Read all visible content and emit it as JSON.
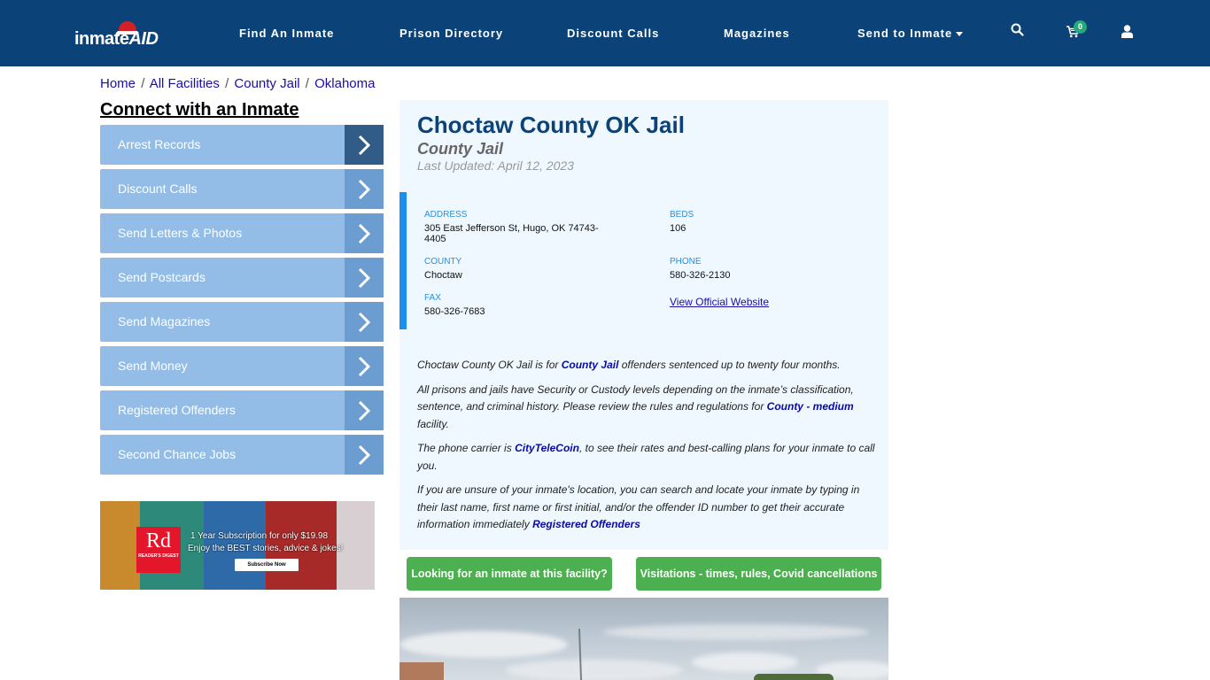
{
  "header": {
    "logo": {
      "part1": "inmate",
      "part2": "AID"
    },
    "nav": [
      {
        "label": "Find An Inmate"
      },
      {
        "label": "Prison Directory"
      },
      {
        "label": "Discount Calls"
      },
      {
        "label": "Magazines"
      },
      {
        "label": "Send to Inmate",
        "has_dropdown": true
      }
    ],
    "icons": {
      "search": "search-icon",
      "cart": "cart-icon",
      "user": "user-icon"
    },
    "cart_count": "0"
  },
  "breadcrumb": [
    {
      "label": "Home"
    },
    {
      "label": "All Facilities"
    },
    {
      "label": "County Jail"
    },
    {
      "label": "Oklahoma"
    }
  ],
  "breadcrumb_separator": "/",
  "sidebar": {
    "title": "Connect with an Inmate",
    "items": [
      {
        "label": "Arrest Records"
      },
      {
        "label": "Discount Calls"
      },
      {
        "label": "Send Letters & Photos"
      },
      {
        "label": "Send Postcards"
      },
      {
        "label": "Send Magazines"
      },
      {
        "label": "Send Money"
      },
      {
        "label": "Registered Offenders"
      },
      {
        "label": "Second Chance Jobs"
      }
    ]
  },
  "ad": {
    "brand_logo": "Rd",
    "brand_name": "READER'S DIGEST",
    "line1": "1 Year Subscription for only $19.98",
    "line2": "Enjoy the BEST stories, advice & jokes!",
    "cta": "Subscribe Now"
  },
  "facility": {
    "name": "Choctaw County OK Jail",
    "type": "County Jail",
    "last_updated": "Last Updated: April 12, 2023",
    "address_label": "ADDRESS",
    "address": "305 East Jefferson St, Hugo, OK 74743-4405",
    "beds_label": "BEDS",
    "beds": "106",
    "county_label": "COUNTY",
    "county": "Choctaw",
    "phone_label": "PHONE",
    "phone": "580-326-2130",
    "fax_label": "FAX",
    "fax": "580-326-7683",
    "website_link": "View Official Website"
  },
  "description": {
    "p1_a": "Choctaw County OK Jail is for ",
    "p1_link": "County Jail",
    "p1_b": " offenders sentenced up to twenty four months.",
    "p2_a": "All prisons and jails have Security or Custody levels depending on the inmate’s classification, sentence, and criminal history. Please review the rules and regulations for ",
    "p2_link": "County - medium",
    "p2_b": " facility.",
    "p3_a": "The phone carrier is ",
    "p3_link": "CityTeleCoin",
    "p3_b": ", to see their rates and best-calling plans for your inmate to call you.",
    "p4_a": "If you are unsure of your inmate's location, you can search and locate your inmate by typing in their last name, first name or first initial, and/or the offender ID number to get their accurate information immediately ",
    "p4_link": "Registered Offenders"
  },
  "actions": {
    "find_inmate": "Looking for an inmate at this facility?",
    "visitation": "Visitations - times, rules, Covid cancellations"
  },
  "colors": {
    "navbar": "#0b4378",
    "sidebar_item": "#93bde6",
    "sidebar_arrow": "#6b9dd0",
    "sidebar_arrow_active": "#315c88",
    "panel_bg": "#eef8fe",
    "accent_border": "#1a8ff0",
    "green_button": "#4caf50",
    "cart_badge": "#24a97a"
  }
}
